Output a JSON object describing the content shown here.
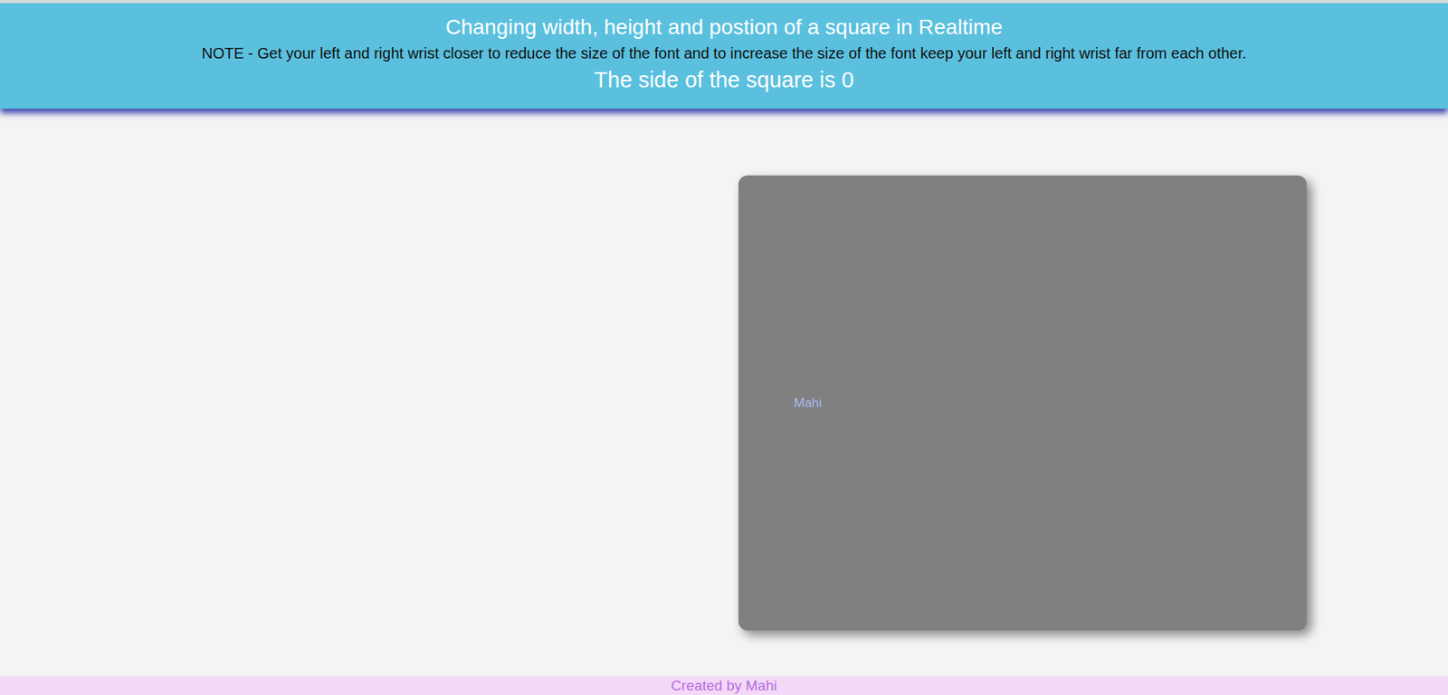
{
  "header": {
    "title": "Changing width, height and postion of a square in Realtime",
    "note": "NOTE - Get your left and right wrist closer to reduce the size of the font and to increase the size of the font keep your left and right wrist far from each other.",
    "reading": "The side of the square is 0"
  },
  "canvas": {
    "square": {
      "label": "Mahi"
    }
  },
  "footer": {
    "text": "Created by Mahi"
  }
}
